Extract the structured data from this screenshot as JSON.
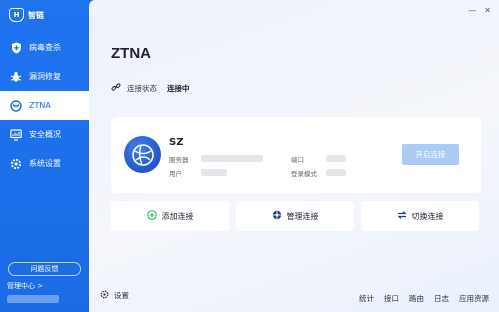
{
  "app": {
    "name": "智链",
    "logo_glyph": "H"
  },
  "sidebar": {
    "items": [
      {
        "label": "病毒查杀",
        "icon": "shield-plus-icon",
        "active": false
      },
      {
        "label": "漏洞修复",
        "icon": "bug-icon",
        "active": false
      },
      {
        "label": "ZTNA",
        "icon": "ztna-icon",
        "active": true
      },
      {
        "label": "安全概况",
        "icon": "monitor-chart-icon",
        "active": false
      },
      {
        "label": "系统设置",
        "icon": "gear-icon",
        "active": false
      }
    ],
    "feedback_label": "问题反馈",
    "manager_label": "管理中心",
    "manager_arrow": ">"
  },
  "window": {
    "minimize": "—",
    "close": "✕"
  },
  "main": {
    "title": "ZTNA",
    "status_label": "连接状态",
    "status_value": "连接中"
  },
  "server_card": {
    "name": "SZ",
    "server_label": "服务器",
    "user_label": "用户",
    "port_label": "端口",
    "login_mode_label": "登录模式",
    "open_button_label": "开启连接"
  },
  "actions": {
    "add_label": "添加连接",
    "manage_label": "管理连接",
    "switch_label": "切换连接"
  },
  "footer": {
    "settings_label": "设置",
    "links": [
      "统计",
      "接口",
      "路由",
      "日志",
      "应用资源"
    ]
  },
  "colors": {
    "accent": "#1b6be6",
    "disabled_button": "#a9cbf6",
    "add_icon": "#2fb35a"
  }
}
